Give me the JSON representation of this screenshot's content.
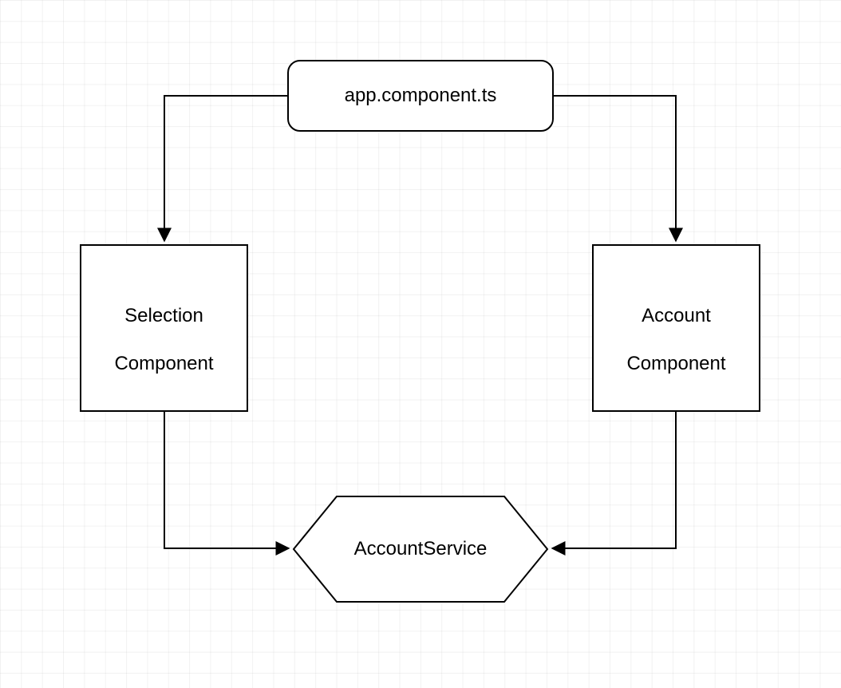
{
  "nodes": {
    "root": {
      "label": "app.component.ts"
    },
    "left": {
      "line1": "Selection",
      "line2": "Component"
    },
    "right": {
      "line1": "Account",
      "line2": "Component"
    },
    "service": {
      "label": "AccountService"
    }
  }
}
